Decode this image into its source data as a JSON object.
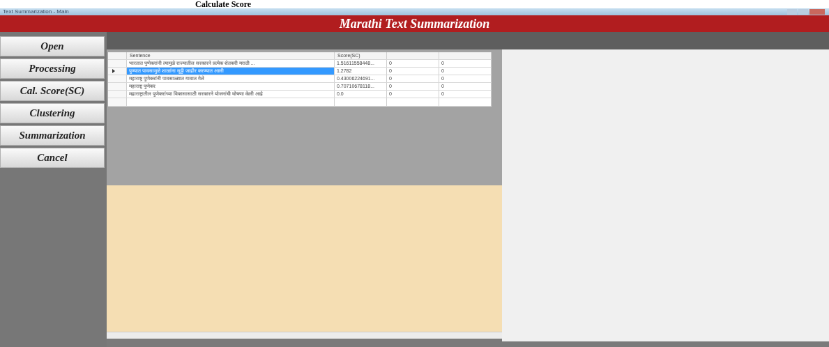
{
  "caption": "Calculate Score",
  "window": {
    "title": "Text Summarization - Main"
  },
  "header": {
    "title": "Marathi Text Summarization"
  },
  "sidebar": {
    "buttons": [
      "Open",
      "Processing",
      "Cal. Score(SC)",
      "Clustering",
      "Summarization",
      "Cancel"
    ]
  },
  "table": {
    "columns": [
      "Sentence",
      "Score(SC)"
    ],
    "rows": [
      {
        "selected": false,
        "cells": [
          "भारतात पुणेकरांनी त्यामुळे राज्यातील सरकारने प्रत्येक शेतकरी मराठी ...",
          "1.51611558448...",
          "0",
          "0"
        ]
      },
      {
        "selected": true,
        "cells": [
          "पुण्यात पावसामुळे शाळांना सुट्टी जाहीर करण्यात आली",
          "1.2782",
          "0",
          "0"
        ]
      },
      {
        "selected": false,
        "cells": [
          "महाराष्ट्र पुणेकरांनी पावसाळ्यात गावात गेले",
          "0.43006224691...",
          "0",
          "0"
        ]
      },
      {
        "selected": false,
        "cells": [
          "महाराष्ट्र पुणेकर",
          "0.70710678118...",
          "0",
          "0"
        ]
      },
      {
        "selected": false,
        "cells": [
          "महाराष्ट्रातील पुणेकरांच्या विकासासाठी सरकारने योजनांची घोषणा केली आहे",
          "0.0",
          "0",
          "0"
        ]
      }
    ]
  }
}
